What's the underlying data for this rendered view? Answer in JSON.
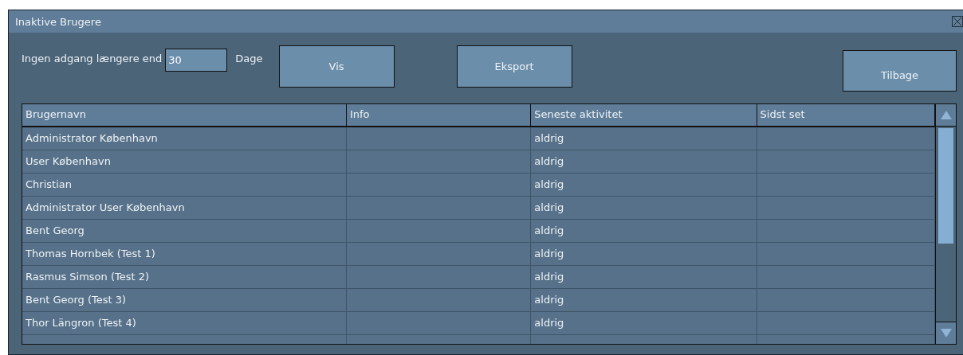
{
  "window": {
    "title": "Inaktive Brugere"
  },
  "filter": {
    "label": "Ingen adgang længere end",
    "value": "30",
    "unit": "Dage"
  },
  "buttons": {
    "show": "Vis",
    "export": "Eksport",
    "back": "Tilbage"
  },
  "table": {
    "columns": [
      "Brugernavn",
      "Info",
      "Seneste aktivitet",
      "Sidst set"
    ],
    "rows": [
      [
        "Administrator København",
        "",
        "aldrig",
        ""
      ],
      [
        "User København",
        "",
        "aldrig",
        ""
      ],
      [
        "Christian",
        "",
        "aldrig",
        ""
      ],
      [
        "Administrator User København",
        "",
        "aldrig",
        ""
      ],
      [
        "Bent Georg",
        "",
        "aldrig",
        ""
      ],
      [
        "Thomas Hornbek (Test 1)",
        "",
        "aldrig",
        ""
      ],
      [
        "Rasmus Simson (Test 2)",
        "",
        "aldrig",
        ""
      ],
      [
        "Bent Georg (Test 3)",
        "",
        "aldrig",
        ""
      ],
      [
        "Thor Längron (Test 4)",
        "",
        "aldrig",
        ""
      ]
    ]
  }
}
